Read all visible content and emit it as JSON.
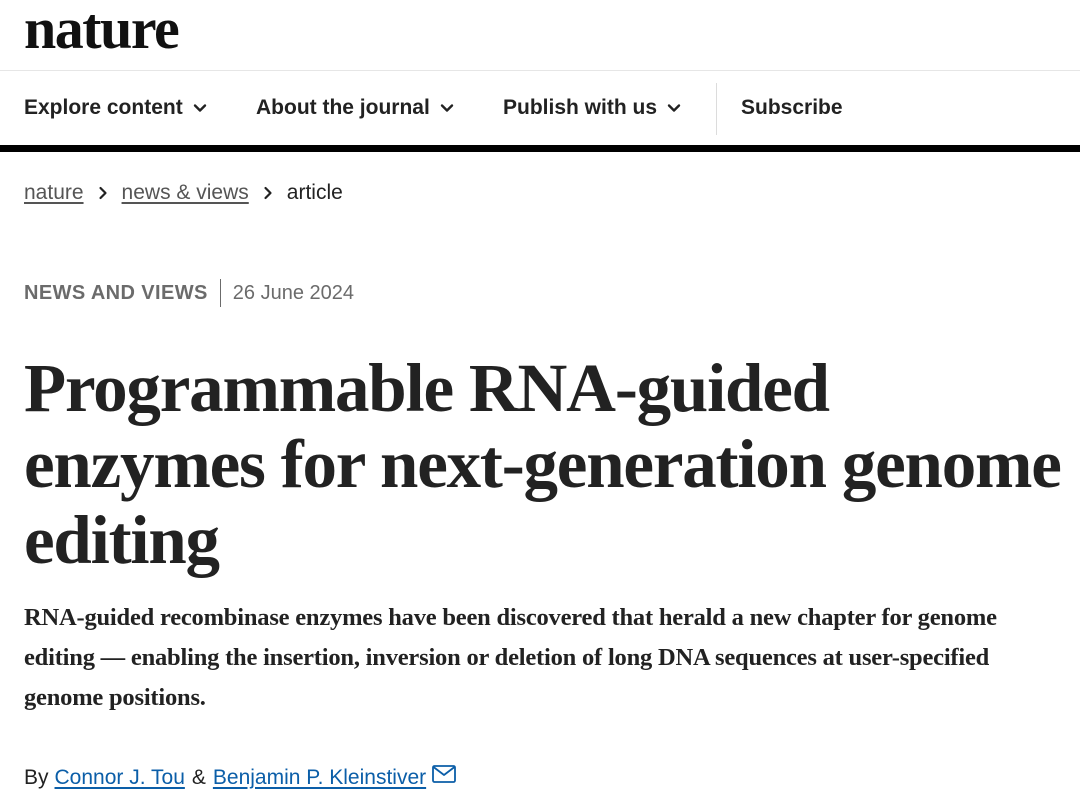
{
  "brand": {
    "logo": "nature"
  },
  "nav": {
    "items": [
      {
        "label": "Explore content",
        "icon": "chevron-down-icon"
      },
      {
        "label": "About the journal",
        "icon": "chevron-down-icon"
      },
      {
        "label": "Publish with us",
        "icon": "chevron-down-icon"
      }
    ],
    "subscribe": "Subscribe"
  },
  "breadcrumb": {
    "items": [
      {
        "label": "nature"
      },
      {
        "label": "news & views"
      }
    ],
    "current": "article",
    "separator_icon": "chevron-right-icon"
  },
  "article": {
    "type": "NEWS AND VIEWS",
    "date": "26 June 2024",
    "title": "Programmable RNA-guided enzymes for next-generation genome editing",
    "standfirst": "RNA-guided recombinase enzymes have been discovered that herald a new chapter for genome editing — enabling the insertion, inversion or deletion of long DNA sequences at user-specified genome positions.",
    "byline": {
      "prefix": "By",
      "authors": [
        "Connor J. Tou",
        "Benjamin P. Kleinstiver"
      ],
      "conjunction": "&",
      "contact_icon": "mail-icon"
    }
  },
  "colors": {
    "text": "#222222",
    "muted": "#6b6b6b",
    "link": "#0b5ea8",
    "rule": "#000000"
  }
}
